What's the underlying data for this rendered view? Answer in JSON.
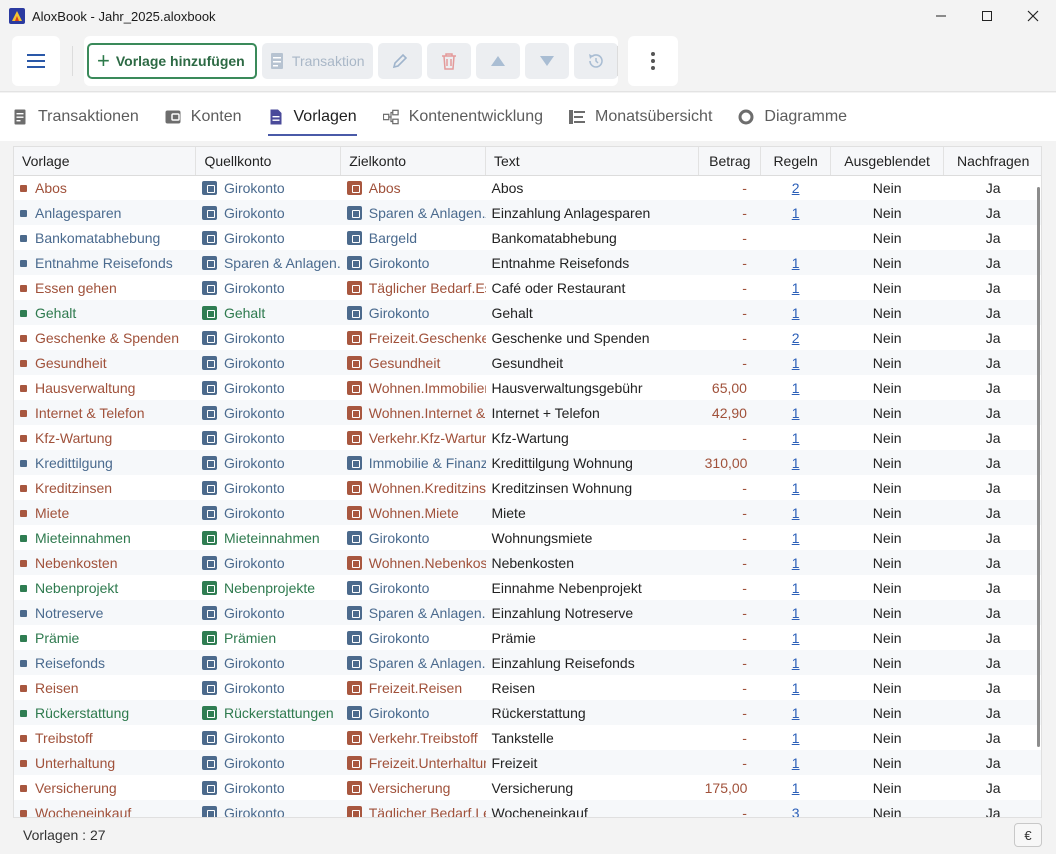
{
  "window": {
    "title": "AloxBook - Jahr_2025.aloxbook"
  },
  "toolbar": {
    "add_label": "Vorlage hinzufügen",
    "transaction_label": "Transaktion"
  },
  "tabs": [
    {
      "label": "Transaktionen",
      "icon": "document-icon"
    },
    {
      "label": "Konten",
      "icon": "wallet-icon"
    },
    {
      "label": "Vorlagen",
      "icon": "template-icon"
    },
    {
      "label": "Kontenentwicklung",
      "icon": "hierarchy-icon"
    },
    {
      "label": "Monatsübersicht",
      "icon": "list-icon"
    },
    {
      "label": "Diagramme",
      "icon": "donut-icon"
    }
  ],
  "table": {
    "columns": [
      "Vorlage",
      "Quellkonto",
      "Zielkonto",
      "Text",
      "Betrag",
      "Regeln",
      "Ausgeblendet",
      "Nachfragen"
    ],
    "rows": [
      {
        "vorlage": "Abos",
        "vc": "red",
        "quelle": "Girokonto",
        "qc": "blue",
        "ziel": "Abos",
        "zc": "red",
        "text": "Abos",
        "betrag": "-",
        "regeln": "2",
        "ausg": "Nein",
        "nach": "Ja"
      },
      {
        "vorlage": "Anlagesparen",
        "vc": "blue",
        "quelle": "Girokonto",
        "qc": "blue",
        "ziel": "Sparen & Anlagen.Anlagesparen",
        "zc": "blue",
        "text": "Einzahlung Anlagesparen",
        "betrag": "-",
        "regeln": "1",
        "ausg": "Nein",
        "nach": "Ja"
      },
      {
        "vorlage": "Bankomatabhebung",
        "vc": "blue",
        "quelle": "Girokonto",
        "qc": "blue",
        "ziel": "Bargeld",
        "zc": "blue",
        "text": "Bankomatabhebung",
        "betrag": "-",
        "regeln": "",
        "ausg": "Nein",
        "nach": "Ja"
      },
      {
        "vorlage": "Entnahme Reisefonds",
        "vc": "blue",
        "quelle": "Sparen & Anlagen.Reisefonds",
        "qc": "blue",
        "ziel": "Girokonto",
        "zc": "blue",
        "text": "Entnahme Reisefonds",
        "betrag": "-",
        "regeln": "1",
        "ausg": "Nein",
        "nach": "Ja"
      },
      {
        "vorlage": "Essen gehen",
        "vc": "red",
        "quelle": "Girokonto",
        "qc": "blue",
        "ziel": "Täglicher Bedarf.Essen gehen",
        "zc": "red",
        "text": "Café oder Restaurant",
        "betrag": "-",
        "regeln": "1",
        "ausg": "Nein",
        "nach": "Ja"
      },
      {
        "vorlage": "Gehalt",
        "vc": "green",
        "quelle": "Gehalt",
        "qc": "green",
        "ziel": "Girokonto",
        "zc": "blue",
        "text": "Gehalt",
        "betrag": "-",
        "regeln": "1",
        "ausg": "Nein",
        "nach": "Ja"
      },
      {
        "vorlage": "Geschenke & Spenden",
        "vc": "red",
        "quelle": "Girokonto",
        "qc": "blue",
        "ziel": "Freizeit.Geschenke & Spenden",
        "zc": "red",
        "text": "Geschenke und Spenden",
        "betrag": "-",
        "regeln": "2",
        "ausg": "Nein",
        "nach": "Ja"
      },
      {
        "vorlage": "Gesundheit",
        "vc": "red",
        "quelle": "Girokonto",
        "qc": "blue",
        "ziel": "Gesundheit",
        "zc": "red",
        "text": "Gesundheit",
        "betrag": "-",
        "regeln": "1",
        "ausg": "Nein",
        "nach": "Ja"
      },
      {
        "vorlage": "Hausverwaltung",
        "vc": "red",
        "quelle": "Girokonto",
        "qc": "blue",
        "ziel": "Wohnen.Immobilienverwaltung",
        "zc": "red",
        "text": "Hausverwaltungsgebühr",
        "betrag": "65,00",
        "regeln": "1",
        "ausg": "Nein",
        "nach": "Ja"
      },
      {
        "vorlage": "Internet & Telefon",
        "vc": "red",
        "quelle": "Girokonto",
        "qc": "blue",
        "ziel": "Wohnen.Internet & Telefon",
        "zc": "red",
        "text": "Internet + Telefon",
        "betrag": "42,90",
        "regeln": "1",
        "ausg": "Nein",
        "nach": "Ja"
      },
      {
        "vorlage": "Kfz-Wartung",
        "vc": "red",
        "quelle": "Girokonto",
        "qc": "blue",
        "ziel": "Verkehr.Kfz-Wartung",
        "zc": "red",
        "text": "Kfz-Wartung",
        "betrag": "-",
        "regeln": "1",
        "ausg": "Nein",
        "nach": "Ja"
      },
      {
        "vorlage": "Kredittilgung",
        "vc": "blue",
        "quelle": "Girokonto",
        "qc": "blue",
        "ziel": "Immobilie & Finanzierung",
        "zc": "blue",
        "text": "Kredittilgung Wohnung",
        "betrag": "310,00",
        "regeln": "1",
        "ausg": "Nein",
        "nach": "Ja"
      },
      {
        "vorlage": "Kreditzinsen",
        "vc": "red",
        "quelle": "Girokonto",
        "qc": "blue",
        "ziel": "Wohnen.Kreditzinsen",
        "zc": "red",
        "text": "Kreditzinsen Wohnung",
        "betrag": "-",
        "regeln": "1",
        "ausg": "Nein",
        "nach": "Ja"
      },
      {
        "vorlage": "Miete",
        "vc": "red",
        "quelle": "Girokonto",
        "qc": "blue",
        "ziel": "Wohnen.Miete",
        "zc": "red",
        "text": "Miete",
        "betrag": "-",
        "regeln": "1",
        "ausg": "Nein",
        "nach": "Ja"
      },
      {
        "vorlage": "Mieteinnahmen",
        "vc": "green",
        "quelle": "Mieteinnahmen",
        "qc": "green",
        "ziel": "Girokonto",
        "zc": "blue",
        "text": "Wohnungsmiete",
        "betrag": "-",
        "regeln": "1",
        "ausg": "Nein",
        "nach": "Ja"
      },
      {
        "vorlage": "Nebenkosten",
        "vc": "red",
        "quelle": "Girokonto",
        "qc": "blue",
        "ziel": "Wohnen.Nebenkosten",
        "zc": "red",
        "text": "Nebenkosten",
        "betrag": "-",
        "regeln": "1",
        "ausg": "Nein",
        "nach": "Ja"
      },
      {
        "vorlage": "Nebenprojekt",
        "vc": "green",
        "quelle": "Nebenprojekte",
        "qc": "green",
        "ziel": "Girokonto",
        "zc": "blue",
        "text": "Einnahme Nebenprojekt",
        "betrag": "-",
        "regeln": "1",
        "ausg": "Nein",
        "nach": "Ja"
      },
      {
        "vorlage": "Notreserve",
        "vc": "blue",
        "quelle": "Girokonto",
        "qc": "blue",
        "ziel": "Sparen & Anlagen.Notreserve",
        "zc": "blue",
        "text": "Einzahlung Notreserve",
        "betrag": "-",
        "regeln": "1",
        "ausg": "Nein",
        "nach": "Ja"
      },
      {
        "vorlage": "Prämie",
        "vc": "green",
        "quelle": "Prämien",
        "qc": "green",
        "ziel": "Girokonto",
        "zc": "blue",
        "text": "Prämie",
        "betrag": "-",
        "regeln": "1",
        "ausg": "Nein",
        "nach": "Ja"
      },
      {
        "vorlage": "Reisefonds",
        "vc": "blue",
        "quelle": "Girokonto",
        "qc": "blue",
        "ziel": "Sparen & Anlagen.Reisefonds",
        "zc": "blue",
        "text": "Einzahlung Reisefonds",
        "betrag": "-",
        "regeln": "1",
        "ausg": "Nein",
        "nach": "Ja"
      },
      {
        "vorlage": "Reisen",
        "vc": "red",
        "quelle": "Girokonto",
        "qc": "blue",
        "ziel": "Freizeit.Reisen",
        "zc": "red",
        "text": "Reisen",
        "betrag": "-",
        "regeln": "1",
        "ausg": "Nein",
        "nach": "Ja"
      },
      {
        "vorlage": "Rückerstattung",
        "vc": "green",
        "quelle": "Rückerstattungen",
        "qc": "green",
        "ziel": "Girokonto",
        "zc": "blue",
        "text": "Rückerstattung",
        "betrag": "-",
        "regeln": "1",
        "ausg": "Nein",
        "nach": "Ja"
      },
      {
        "vorlage": "Treibstoff",
        "vc": "red",
        "quelle": "Girokonto",
        "qc": "blue",
        "ziel": "Verkehr.Treibstoff",
        "zc": "red",
        "text": "Tankstelle",
        "betrag": "-",
        "regeln": "1",
        "ausg": "Nein",
        "nach": "Ja"
      },
      {
        "vorlage": "Unterhaltung",
        "vc": "red",
        "quelle": "Girokonto",
        "qc": "blue",
        "ziel": "Freizeit.Unterhaltung",
        "zc": "red",
        "text": "Freizeit",
        "betrag": "-",
        "regeln": "1",
        "ausg": "Nein",
        "nach": "Ja"
      },
      {
        "vorlage": "Versicherung",
        "vc": "red",
        "quelle": "Girokonto",
        "qc": "blue",
        "ziel": "Versicherung",
        "zc": "red",
        "text": "Versicherung",
        "betrag": "175,00",
        "regeln": "1",
        "ausg": "Nein",
        "nach": "Ja"
      },
      {
        "vorlage": "Wocheneinkauf",
        "vc": "red",
        "quelle": "Girokonto",
        "qc": "blue",
        "ziel": "Täglicher Bedarf.Lebensmittel",
        "zc": "red",
        "text": "Wocheneinkauf",
        "betrag": "-",
        "regeln": "3",
        "ausg": "Nein",
        "nach": "Ja"
      }
    ]
  },
  "status": {
    "label": "Vorlagen : 27",
    "currency": "€"
  },
  "colors": {
    "accent": "#4a5aa8",
    "blue": "#4c6a8c",
    "red": "#a8573f",
    "green": "#2f7d52",
    "add_border": "#3a8a5a"
  }
}
